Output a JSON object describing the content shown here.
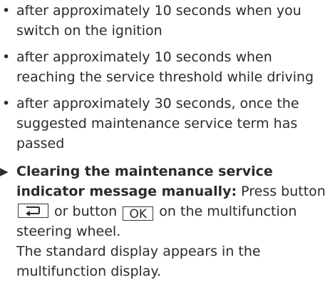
{
  "bullets": [
    "after approximately 10 seconds when you switch on the ignition",
    "after approximately 10 seconds when reaching the service threshold while driving",
    "after approximately 30 seconds, once the suggested maintenance service term has passed"
  ],
  "bullet_symbol": "•",
  "step": {
    "arrow": "▶",
    "title": "Clearing the maintenance service indicator message manually:",
    "text_before": "Press button",
    "back_key_icon": "back-arrow-icon",
    "text_middle": "or button",
    "ok_key_label": "OK",
    "text_after": "on the multifunction steering wheel.",
    "result": "The standard display appears in the multifunction display."
  }
}
